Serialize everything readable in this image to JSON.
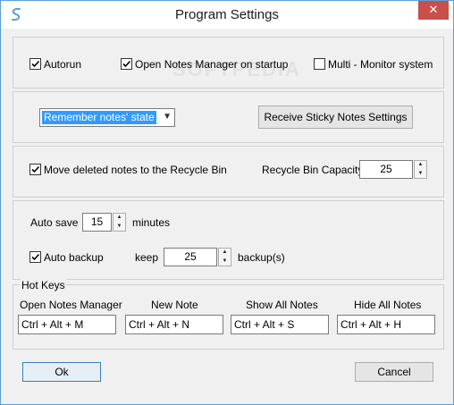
{
  "window": {
    "title": "Program Settings",
    "close_glyph": "✕",
    "app_icon": "sticky-notes-s-icon",
    "watermark": "SOFTPEDIA"
  },
  "general": {
    "autorun": {
      "label": "Autorun",
      "checked": true
    },
    "open_manager": {
      "label": "Open Notes Manager on startup",
      "checked": true
    },
    "multi_monitor": {
      "label": "Multi - Monitor system",
      "checked": false
    }
  },
  "state": {
    "combo_value": "Remember notes' state",
    "receive_button": "Receive Sticky Notes Settings"
  },
  "recycle": {
    "move_deleted": {
      "label": "Move deleted notes to the Recycle Bin",
      "checked": true
    },
    "capacity_label": "Recycle Bin Capacity",
    "capacity_value": "25"
  },
  "save": {
    "auto_save_label": "Auto save",
    "auto_save_value": "15",
    "minutes_label": "minutes",
    "auto_backup": {
      "label": "Auto backup",
      "checked": true
    },
    "keep_label": "keep",
    "keep_value": "25",
    "backups_label": "backup(s)"
  },
  "hotkeys": {
    "title": "Hot Keys",
    "items": [
      {
        "label": "Open Notes Manager",
        "value": "Ctrl + Alt + M"
      },
      {
        "label": "New Note",
        "value": "Ctrl + Alt + N"
      },
      {
        "label": "Show All Notes",
        "value": "Ctrl + Alt + S"
      },
      {
        "label": "Hide All Notes",
        "value": "Ctrl + Alt + H"
      }
    ]
  },
  "footer": {
    "ok_label": "Ok",
    "cancel_label": "Cancel"
  },
  "colors": {
    "window_border": "#5a9fd4",
    "close_button": "#c7504b",
    "selection": "#3399ff"
  }
}
